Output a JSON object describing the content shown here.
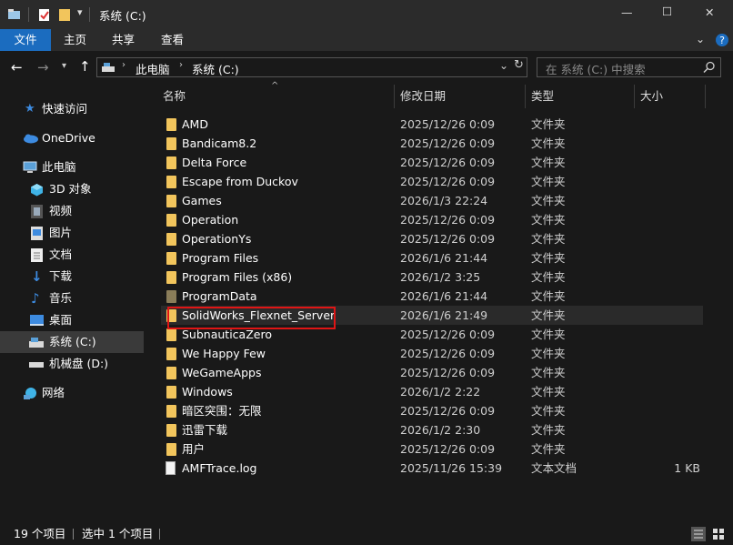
{
  "window": {
    "title": "系统 (C:)",
    "controls": {
      "minimize": "—",
      "maximize": "☐",
      "close": "✕"
    }
  },
  "ribbon": {
    "tabs": [
      {
        "label": "文件",
        "active": true
      },
      {
        "label": "主页",
        "active": false
      },
      {
        "label": "共享",
        "active": false
      },
      {
        "label": "查看",
        "active": false
      }
    ]
  },
  "address": {
    "crumbs": [
      "此电脑",
      "系统 (C:)"
    ],
    "search_placeholder": "在 系统 (C:) 中搜索"
  },
  "nav": {
    "items": [
      {
        "label": "快速访问",
        "icon": "star-icon"
      },
      {
        "label": "OneDrive",
        "icon": "cloud-icon"
      },
      {
        "label": "此电脑",
        "icon": "computer-icon"
      },
      {
        "label": "3D 对象",
        "icon": "cube-icon"
      },
      {
        "label": "视频",
        "icon": "video-icon"
      },
      {
        "label": "图片",
        "icon": "picture-icon"
      },
      {
        "label": "文档",
        "icon": "document-icon"
      },
      {
        "label": "下载",
        "icon": "download-icon"
      },
      {
        "label": "音乐",
        "icon": "music-icon"
      },
      {
        "label": "桌面",
        "icon": "desktop-icon"
      },
      {
        "label": "系统 (C:)",
        "icon": "drive-icon",
        "selected": true
      },
      {
        "label": "机械盘 (D:)",
        "icon": "drive-icon"
      },
      {
        "label": "网络",
        "icon": "network-icon"
      }
    ]
  },
  "columns": {
    "name": "名称",
    "modified": "修改日期",
    "type": "类型",
    "size": "大小"
  },
  "files": [
    {
      "name": "AMD",
      "date": "2025/12/26 0:09",
      "type": "文件夹",
      "size": "",
      "kind": "folder"
    },
    {
      "name": "Bandicam8.2",
      "date": "2025/12/26 0:09",
      "type": "文件夹",
      "size": "",
      "kind": "folder"
    },
    {
      "name": "Delta Force",
      "date": "2025/12/26 0:09",
      "type": "文件夹",
      "size": "",
      "kind": "folder"
    },
    {
      "name": "Escape from Duckov",
      "date": "2025/12/26 0:09",
      "type": "文件夹",
      "size": "",
      "kind": "folder"
    },
    {
      "name": "Games",
      "date": "2026/1/3 22:24",
      "type": "文件夹",
      "size": "",
      "kind": "folder"
    },
    {
      "name": "Operation",
      "date": "2025/12/26 0:09",
      "type": "文件夹",
      "size": "",
      "kind": "folder"
    },
    {
      "name": "OperationYs",
      "date": "2025/12/26 0:09",
      "type": "文件夹",
      "size": "",
      "kind": "folder"
    },
    {
      "name": "Program Files",
      "date": "2026/1/6 21:44",
      "type": "文件夹",
      "size": "",
      "kind": "folder"
    },
    {
      "name": "Program Files (x86)",
      "date": "2026/1/2 3:25",
      "type": "文件夹",
      "size": "",
      "kind": "folder"
    },
    {
      "name": "ProgramData",
      "date": "2026/1/6 21:44",
      "type": "文件夹",
      "size": "",
      "kind": "folder-hidden"
    },
    {
      "name": "SolidWorks_Flexnet_Server",
      "date": "2026/1/6 21:49",
      "type": "文件夹",
      "size": "",
      "kind": "folder",
      "highlighted": true
    },
    {
      "name": "SubnauticaZero",
      "date": "2025/12/26 0:09",
      "type": "文件夹",
      "size": "",
      "kind": "folder"
    },
    {
      "name": "We Happy Few",
      "date": "2025/12/26 0:09",
      "type": "文件夹",
      "size": "",
      "kind": "folder"
    },
    {
      "name": "WeGameApps",
      "date": "2025/12/26 0:09",
      "type": "文件夹",
      "size": "",
      "kind": "folder"
    },
    {
      "name": "Windows",
      "date": "2026/1/2 2:22",
      "type": "文件夹",
      "size": "",
      "kind": "folder"
    },
    {
      "name": "暗区突围：无限",
      "date": "2025/12/26 0:09",
      "type": "文件夹",
      "size": "",
      "kind": "folder"
    },
    {
      "name": "迅雷下载",
      "date": "2026/1/2 2:30",
      "type": "文件夹",
      "size": "",
      "kind": "folder"
    },
    {
      "name": "用户",
      "date": "2025/12/26 0:09",
      "type": "文件夹",
      "size": "",
      "kind": "folder"
    },
    {
      "name": "AMFTrace.log",
      "date": "2025/11/26 15:39",
      "type": "文本文档",
      "size": "1 KB",
      "kind": "file"
    }
  ],
  "status": {
    "count": "19 个项目",
    "selected": "选中 1 个项目"
  },
  "colors": {
    "accent": "#1b6cbf",
    "highlight_border": "#e01515",
    "folder": "#f2c55c"
  }
}
